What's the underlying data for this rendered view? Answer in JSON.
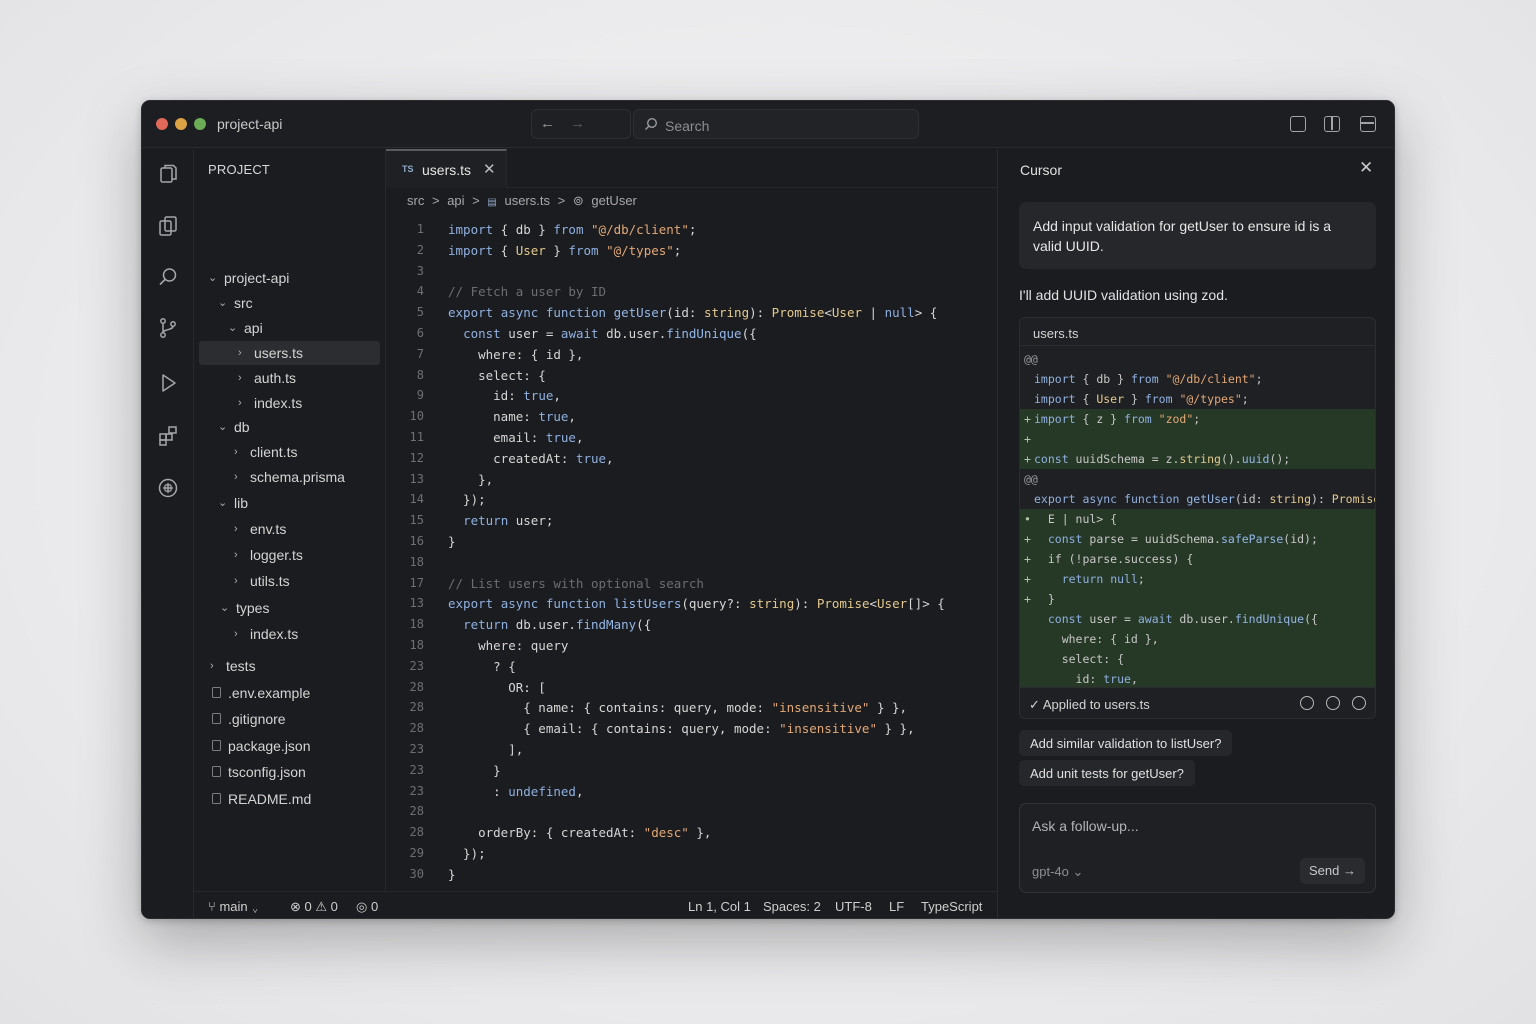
{
  "window": {
    "title": "project-api"
  },
  "search": {
    "placeholder": "Search"
  },
  "explorer": {
    "title": "PROJECT",
    "items": [
      {
        "label": "project-api",
        "type": "folder-open"
      },
      {
        "label": "src",
        "type": "folder-open"
      },
      {
        "label": "api",
        "type": "folder-open"
      },
      {
        "label": "users.ts",
        "type": "file",
        "active": true
      },
      {
        "label": "auth.ts",
        "type": "file"
      },
      {
        "label": "index.ts",
        "type": "file"
      },
      {
        "label": "db",
        "type": "folder-open"
      },
      {
        "label": "client.ts",
        "type": "file"
      },
      {
        "label": "schema.prisma",
        "type": "file"
      },
      {
        "label": "lib",
        "type": "folder-open"
      },
      {
        "label": "env.ts",
        "type": "file"
      },
      {
        "label": "logger.ts",
        "type": "file"
      },
      {
        "label": "utils.ts",
        "type": "file"
      },
      {
        "label": "types",
        "type": "folder-open"
      },
      {
        "label": "index.ts",
        "type": "file"
      },
      {
        "label": "tests",
        "type": "folder-closed"
      },
      {
        "label": ".env.example",
        "type": "file"
      },
      {
        "label": ".gitignore",
        "type": "file"
      },
      {
        "label": "package.json",
        "type": "file"
      },
      {
        "label": "tsconfig.json",
        "type": "file"
      },
      {
        "label": "README.md",
        "type": "file"
      }
    ]
  },
  "editor": {
    "tab": {
      "lang": "TS",
      "name": "users.ts"
    },
    "breadcrumb": [
      "src",
      ">",
      "api",
      ">",
      "users.ts",
      ">",
      "getUser"
    ],
    "lines": [
      {
        "n": "1",
        "code": "import { db } from \"@/db/client\";"
      },
      {
        "n": "2",
        "code": "import { User } from \"@/types\";"
      },
      {
        "n": "3",
        "code": ""
      },
      {
        "n": "4",
        "code": "// Fetch a user by ID"
      },
      {
        "n": "5",
        "code": "export async function getUser(id: string): Promise<User | null> {"
      },
      {
        "n": "6",
        "code": "  const user = await db.user.findUnique({"
      },
      {
        "n": "7",
        "code": "    where: { id },"
      },
      {
        "n": "8",
        "code": "    select: {"
      },
      {
        "n": "9",
        "code": "      id: true,"
      },
      {
        "n": "10",
        "code": "      name: true,"
      },
      {
        "n": "11",
        "code": "      email: true,"
      },
      {
        "n": "12",
        "code": "      createdAt: true,"
      },
      {
        "n": "13",
        "code": "    },"
      },
      {
        "n": "14",
        "code": "  });"
      },
      {
        "n": "15",
        "code": "  return user;"
      },
      {
        "n": "16",
        "code": "}"
      },
      {
        "n": "18",
        "code": ""
      },
      {
        "n": "17",
        "code": "// List users with optional search"
      },
      {
        "n": "13",
        "code": "export async function listUsers(query?: string): Promise<User[]> {"
      },
      {
        "n": "18",
        "code": "  return db.user.findMany({"
      },
      {
        "n": "18",
        "code": "    where: query"
      },
      {
        "n": "23",
        "code": "      ? {"
      },
      {
        "n": "28",
        "code": "        OR: ["
      },
      {
        "n": "28",
        "code": "          { name: { contains: query, mode: \"insensitive\" } },"
      },
      {
        "n": "28",
        "code": "          { email: { contains: query, mode: \"insensitive\" } },"
      },
      {
        "n": "23",
        "code": "        ],"
      },
      {
        "n": "23",
        "code": "      }"
      },
      {
        "n": "23",
        "code": "      : undefined,"
      },
      {
        "n": "28",
        "code": ""
      },
      {
        "n": "28",
        "code": "    orderBy: { createdAt: \"desc\" },"
      },
      {
        "n": "29",
        "code": "  });"
      },
      {
        "n": "30",
        "code": "}"
      }
    ]
  },
  "statusbar": {
    "branch": "main",
    "errors": "0",
    "warnings": "0",
    "ports": "0",
    "position": "Ln 1, Col 1",
    "spaces": "Spaces: 2",
    "encoding": "UTF-8",
    "eol": "LF",
    "language": "TypeScript"
  },
  "chat": {
    "title": "Cursor",
    "user_message": "Add input validation for getUser to ensure id is a valid UUID.",
    "assistant_message": "I'll add UUID validation using zod.",
    "diff": {
      "file": "users.ts",
      "lines": [
        {
          "kind": "hunk",
          "mark": "",
          "text": "@@"
        },
        {
          "kind": "ctx",
          "mark": "",
          "text": "import { db } from \"@/db/client\";"
        },
        {
          "kind": "ctx",
          "mark": "",
          "text": "import { User } from \"@/types\";"
        },
        {
          "kind": "add",
          "mark": "+",
          "text": "import { z } from \"zod\";"
        },
        {
          "kind": "add",
          "mark": "+",
          "text": ""
        },
        {
          "kind": "add",
          "mark": "+",
          "text": "const uuidSchema = z.string().uuid();"
        },
        {
          "kind": "hunk",
          "mark": "",
          "text": "@@"
        },
        {
          "kind": "ctx",
          "mark": "",
          "text": "export async function getUser(id: string): Promise<"
        },
        {
          "kind": "add",
          "mark": "•",
          "text": "  E | nul> {"
        },
        {
          "kind": "add",
          "mark": "+",
          "text": "  const parse = uuidSchema.safeParse(id);"
        },
        {
          "kind": "add",
          "mark": "+",
          "text": "  if (!parse.success) {"
        },
        {
          "kind": "add",
          "mark": "+",
          "text": "    return null;"
        },
        {
          "kind": "add",
          "mark": "+",
          "text": "  }"
        },
        {
          "kind": "add",
          "mark": "",
          "text": "  const user = await db.user.findUnique({"
        },
        {
          "kind": "add",
          "mark": "",
          "text": "    where: { id },"
        },
        {
          "kind": "add",
          "mark": "",
          "text": "    select: {"
        },
        {
          "kind": "add",
          "mark": "",
          "text": "      id: true,"
        }
      ],
      "status": "Applied to users.ts"
    },
    "suggestions": [
      "Add similar validation to listUser?",
      "Add unit tests for getUser?"
    ],
    "composer": {
      "placeholder": "Ask a follow-up...",
      "model": "gpt-4o",
      "send_label": "Send"
    }
  },
  "colors": {
    "accent_add": "#263826",
    "background": "#1b1c1f"
  }
}
